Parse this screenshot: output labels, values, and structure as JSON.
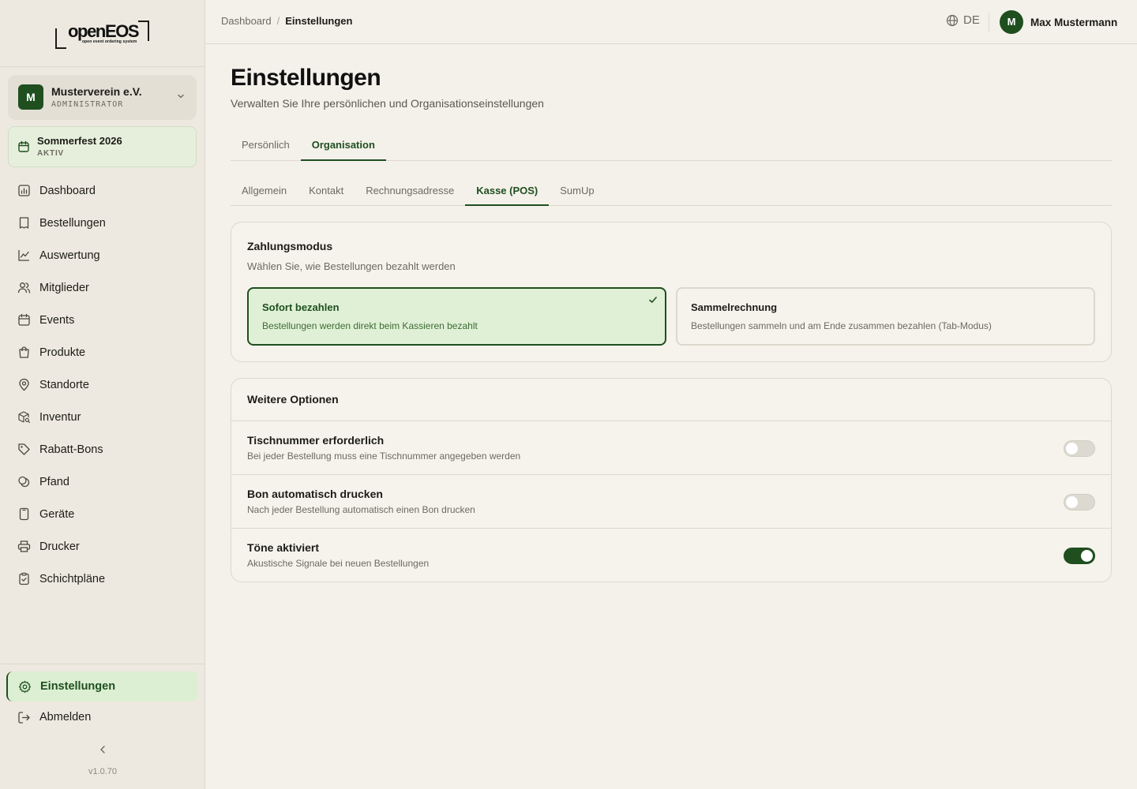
{
  "brand": {
    "wordmark": "openEOS",
    "tagline": "open event ordering system"
  },
  "org": {
    "avatar": "M",
    "name": "Musterverein e.V.",
    "role": "ADMINISTRATOR"
  },
  "event": {
    "name": "Sommerfest 2026",
    "status": "AKTIV"
  },
  "sidebar": {
    "items": [
      {
        "label": "Dashboard",
        "icon": "chart-icon"
      },
      {
        "label": "Bestellungen",
        "icon": "receipt-icon"
      },
      {
        "label": "Auswertung",
        "icon": "trend-icon"
      },
      {
        "label": "Mitglieder",
        "icon": "users-icon"
      },
      {
        "label": "Events",
        "icon": "calendar-icon"
      },
      {
        "label": "Produkte",
        "icon": "bag-icon"
      },
      {
        "label": "Standorte",
        "icon": "map-pin-icon"
      },
      {
        "label": "Inventur",
        "icon": "box-search-icon"
      },
      {
        "label": "Rabatt-Bons",
        "icon": "tag-icon"
      },
      {
        "label": "Pfand",
        "icon": "coins-icon"
      },
      {
        "label": "Geräte",
        "icon": "tablet-icon"
      },
      {
        "label": "Drucker",
        "icon": "printer-icon"
      },
      {
        "label": "Schichtpläne",
        "icon": "clipboard-check-icon"
      }
    ],
    "settings_label": "Einstellungen",
    "logout_label": "Abmelden",
    "version": "v1.0.70"
  },
  "topbar": {
    "breadcrumb": {
      "home": "Dashboard",
      "separator": "/",
      "current": "Einstellungen"
    },
    "language": "DE",
    "user": {
      "avatar": "M",
      "name": "Max Mustermann"
    }
  },
  "page": {
    "title": "Einstellungen",
    "subtitle": "Verwalten Sie Ihre persönlichen und Organisationseinstellungen"
  },
  "tabs": [
    "Persönlich",
    "Organisation"
  ],
  "active_tab": "Organisation",
  "subtabs": [
    "Allgemein",
    "Kontakt",
    "Rechnungsadresse",
    "Kasse (POS)",
    "SumUp"
  ],
  "active_subtab": "Kasse (POS)",
  "payment_mode": {
    "title": "Zahlungsmodus",
    "description": "Wählen Sie, wie Bestellungen bezahlt werden",
    "options": [
      {
        "title": "Sofort bezahlen",
        "description": "Bestellungen werden direkt beim Kassieren bezahlt",
        "selected": true
      },
      {
        "title": "Sammelrechnung",
        "description": "Bestellungen sammeln und am Ende zusammen bezahlen (Tab-Modus)",
        "selected": false
      }
    ]
  },
  "more_options": {
    "title": "Weitere Optionen",
    "rows": [
      {
        "title": "Tischnummer erforderlich",
        "description": "Bei jeder Bestellung muss eine Tischnummer angegeben werden",
        "enabled": false
      },
      {
        "title": "Bon automatisch drucken",
        "description": "Nach jeder Bestellung automatisch einen Bon drucken",
        "enabled": false
      },
      {
        "title": "Töne aktiviert",
        "description": "Akustische Signale bei neuen Bestellungen",
        "enabled": true
      }
    ]
  },
  "colors": {
    "accent": "#1f4f1f",
    "background": "#f4f1ea",
    "sidebar": "#ede9e0",
    "selected_bg": "#dff0d6"
  }
}
